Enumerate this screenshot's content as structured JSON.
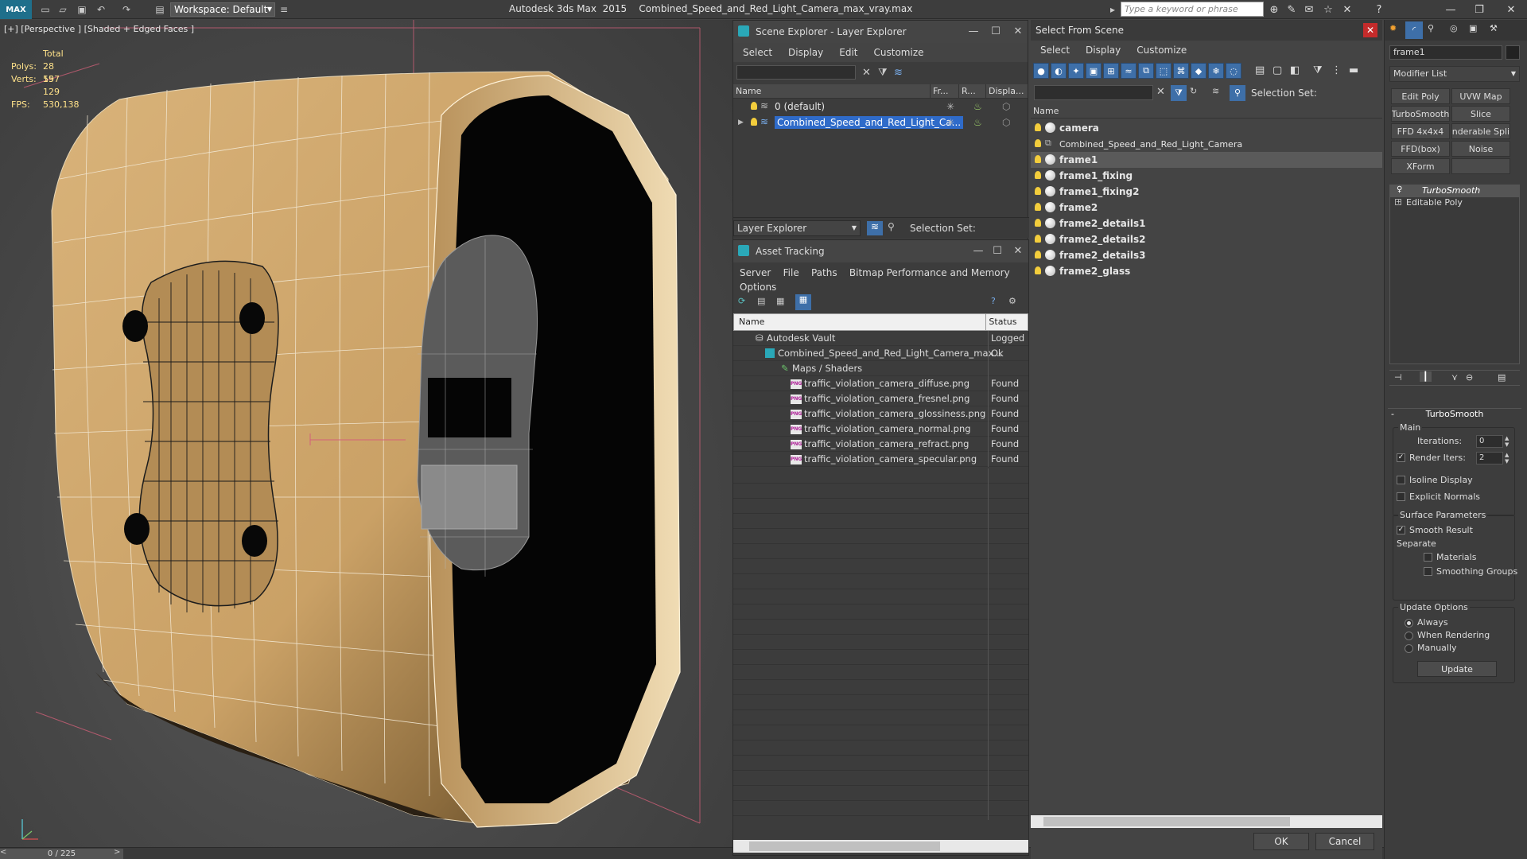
{
  "titlebar": {
    "logo": "MAX",
    "workspace": "Workspace: Default",
    "app_title": "Autodesk 3ds Max  2015    Combined_Speed_and_Red_Light_Camera_max_vray.max",
    "search_placeholder": "Type a keyword or phrase"
  },
  "viewport": {
    "label": "[+] [Perspective ] [Shaded + Edged Faces ]",
    "stats": {
      "total_label": "Total",
      "polys_label": "Polys:",
      "polys_value": "28 597",
      "verts_label": "Verts:",
      "verts_value": "15 129",
      "fps_label": "FPS:",
      "fps_value": "530,138"
    },
    "frame_counter": "0 / 225"
  },
  "scene_explorer": {
    "title": "Scene Explorer - Layer Explorer",
    "menu": [
      "Select",
      "Display",
      "Edit",
      "Customize"
    ],
    "columns": [
      "Name",
      "Fr...",
      "R...",
      "Displa..."
    ],
    "rows": [
      {
        "name": "0 (default)"
      },
      {
        "name": "Combined_Speed_and_Red_Light_Ca..."
      }
    ],
    "footer_dropdown": "Layer Explorer",
    "footer_selection": "Selection Set:"
  },
  "asset_tracking": {
    "title": "Asset Tracking",
    "menu": [
      "Server",
      "File",
      "Paths",
      "Bitmap Performance and Memory",
      "Options"
    ],
    "columns": [
      "Name",
      "Status"
    ],
    "rows": [
      {
        "name": "Autodesk Vault",
        "status": "Logged"
      },
      {
        "name": "Combined_Speed_and_Red_Light_Camera_max...",
        "status": "Ok"
      },
      {
        "name": "Maps / Shaders",
        "status": ""
      },
      {
        "name": "traffic_violation_camera_diffuse.png",
        "status": "Found"
      },
      {
        "name": "traffic_violation_camera_fresnel.png",
        "status": "Found"
      },
      {
        "name": "traffic_violation_camera_glossiness.png",
        "status": "Found"
      },
      {
        "name": "traffic_violation_camera_normal.png",
        "status": "Found"
      },
      {
        "name": "traffic_violation_camera_refract.png",
        "status": "Found"
      },
      {
        "name": "traffic_violation_camera_specular.png",
        "status": "Found"
      }
    ],
    "png_badge": "PNG"
  },
  "select_from_scene": {
    "title": "Select From Scene",
    "menu": [
      "Select",
      "Display",
      "Customize"
    ],
    "selection_set": "Selection Set:",
    "column": "Name",
    "rows": [
      {
        "name": "camera"
      },
      {
        "name": "Combined_Speed_and_Red_Light_Camera"
      },
      {
        "name": "frame1"
      },
      {
        "name": "frame1_fixing"
      },
      {
        "name": "frame1_fixing2"
      },
      {
        "name": "frame2"
      },
      {
        "name": "frame2_details1"
      },
      {
        "name": "frame2_details2"
      },
      {
        "name": "frame2_details3"
      },
      {
        "name": "frame2_glass"
      }
    ],
    "ok": "OK",
    "cancel": "Cancel"
  },
  "command_panel": {
    "object_name": "frame1",
    "modifier_list": "Modifier List",
    "buttons": [
      "Edit Poly",
      "UVW Map",
      "TurboSmooth",
      "Slice",
      "FFD 4x4x4",
      "enderable Splin",
      "FFD(box)",
      "Noise",
      "XForm"
    ],
    "stack": [
      "TurboSmooth",
      "Editable Poly"
    ],
    "rollout_title": "TurboSmooth",
    "main_group": "Main",
    "iterations_label": "Iterations:",
    "iterations_value": "0",
    "render_iters_label": "Render Iters:",
    "render_iters_value": "2",
    "isoline": "Isoline Display",
    "explicit_normals": "Explicit Normals",
    "surface_group": "Surface Parameters",
    "smooth_result": "Smooth Result",
    "separate": "Separate",
    "materials": "Materials",
    "smoothing_groups": "Smoothing Groups",
    "update_group": "Update Options",
    "always": "Always",
    "when_rendering": "When Rendering",
    "manually": "Manually",
    "update_button": "Update"
  }
}
